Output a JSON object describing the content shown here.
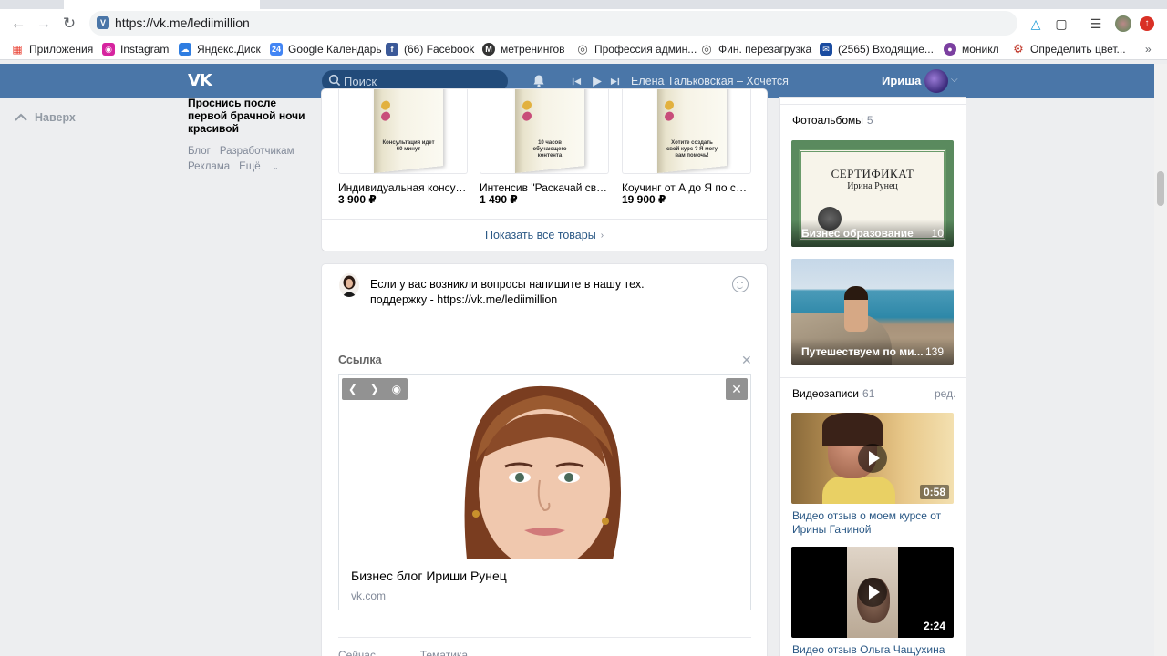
{
  "browser": {
    "url": "https://vk.me/lediimillion",
    "bookmarks": [
      {
        "label": "Приложения",
        "icon": "apps-grid-icon",
        "color": "#ea4335"
      },
      {
        "label": "Instagram",
        "icon": "instagram-icon",
        "color": "#d6249f"
      },
      {
        "label": "Яндекс.Диск",
        "icon": "yandex-disk-icon",
        "color": "#2f7de1"
      },
      {
        "label": "Google Календарь",
        "icon": "google-calendar-icon",
        "color": "#4285f4"
      },
      {
        "label": "(66) Facebook",
        "icon": "facebook-icon",
        "color": "#3b5998"
      },
      {
        "label": "метренингов",
        "icon": "metreningov-icon",
        "color": "#333333"
      },
      {
        "label": "Профессия админ...",
        "icon": "target-icon",
        "color": "#555555"
      },
      {
        "label": "Фин. перезагрузка",
        "icon": "target-icon",
        "color": "#555555"
      },
      {
        "label": "(2565) Входящие...",
        "icon": "mail-icon",
        "color": "#1a4ca0"
      },
      {
        "label": "моникл",
        "icon": "monikl-icon",
        "color": "#7b3fa0"
      },
      {
        "label": "Определить цвет...",
        "icon": "gear-icon",
        "color": "#c0392b"
      }
    ]
  },
  "vk_header": {
    "logo": "VK",
    "search_placeholder": "Поиск",
    "now_playing": "Елена Тальковская – Хочется",
    "user_name": "Ириша"
  },
  "left_nav": {
    "to_top": "Наверх",
    "ad_text": "Проснись после первой брачной ночи красивой",
    "links": [
      "Блог",
      "Разработчикам",
      "Реклама",
      "Ещё"
    ]
  },
  "products": {
    "items": [
      {
        "name": "Индивидуальная консультация",
        "price": "3 900 ₽",
        "box_text": "Консультация идет 60 минут"
      },
      {
        "name": "Интенсив \"Раскачай свой...",
        "price": "1 490 ₽",
        "box_text": "10 часов обучающего контента"
      },
      {
        "name": "Коучинг от А до Я по созданию",
        "price": "19 900 ₽",
        "box_text": "Хотите создать свой курс ? Я могу вам помочь!"
      }
    ],
    "show_all": "Показать все товары"
  },
  "post": {
    "text": "Если у вас возникли вопросы напишите в нашу тех. поддержку - https://vk.me/lediimillion",
    "link_label": "Ссылка",
    "link_title": "Бизнес блог Ириши Рунец",
    "link_domain": "vk.com",
    "options": [
      "Сейчас",
      "Тематика"
    ]
  },
  "right_col": {
    "albums_label": "Фотоальбомы",
    "albums_count": "5",
    "albums": [
      {
        "title": "Бизнес образование",
        "count": "10",
        "cert_title": "СЕРТИФИКАТ",
        "cert_name": "Ирина Рунец"
      },
      {
        "title": "Путешествуем по ми...",
        "count": "139"
      }
    ],
    "videos_label": "Видеозаписи",
    "videos_count": "61",
    "videos_edit": "ред.",
    "videos": [
      {
        "title": "Видео отзыв о моем курсе от Ирины Ганиной",
        "duration": "0:58"
      },
      {
        "title": "Видео отзыв Ольга Чащухина о",
        "duration": "2:24"
      }
    ]
  }
}
